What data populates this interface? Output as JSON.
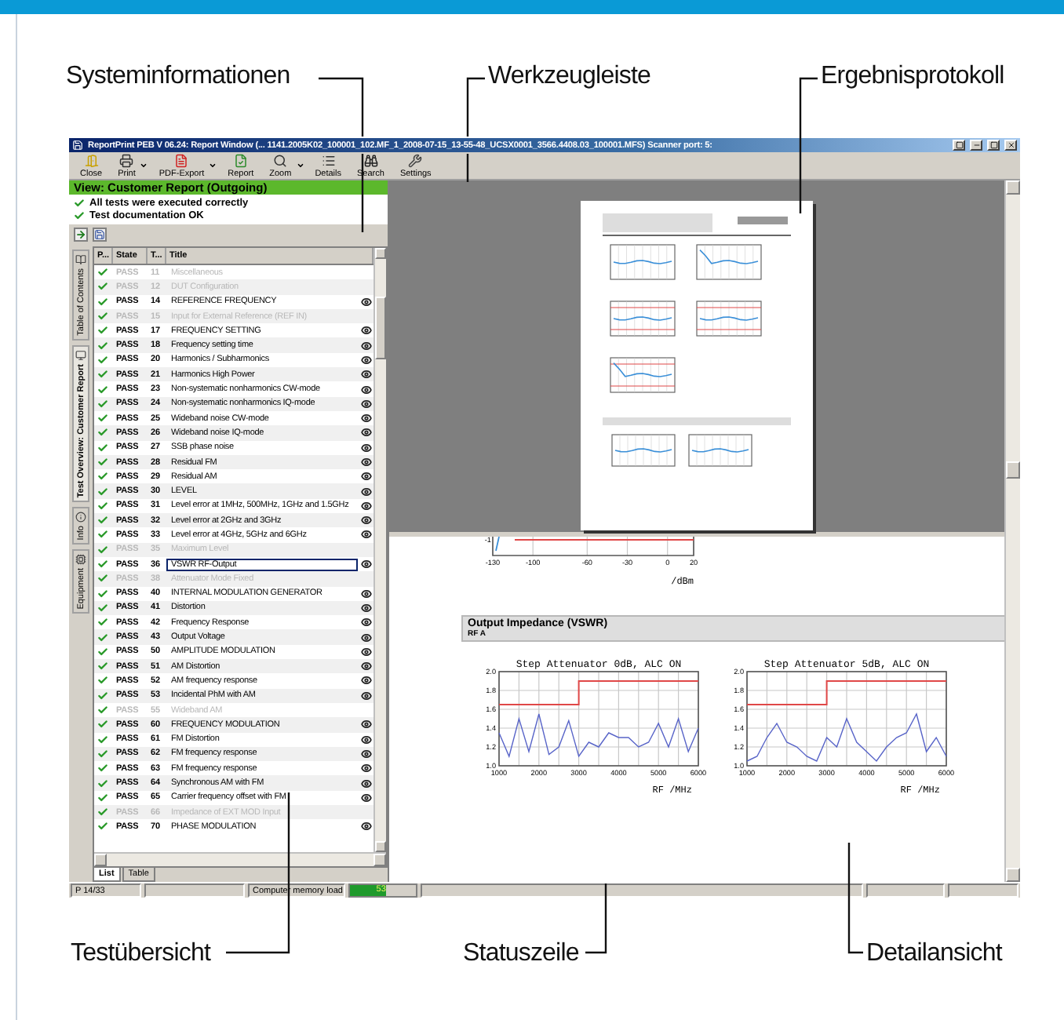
{
  "top_labels": [
    {
      "text": "Systeminformationen"
    },
    {
      "text": "Werkzeugleiste"
    },
    {
      "text": "Ergebnisprotokoll"
    }
  ],
  "window": {
    "title": "ReportPrint PEB  V 06.24: Report Window (... 1141.2005K02_100001_102.MF_1_2008-07-15_13-55-48_UCSX0001_3566.4408.03_100001.MFS) Scanner port: 5:",
    "toolbar": [
      {
        "label": "Close",
        "kind": "close",
        "dropdown": false
      },
      {
        "label": "Print",
        "kind": "print",
        "dropdown": true
      },
      {
        "label": "PDF-Export",
        "kind": "pdf",
        "dropdown": true
      },
      {
        "label": "Report",
        "kind": "report",
        "dropdown": false
      },
      {
        "label": "Zoom",
        "kind": "zoom",
        "dropdown": true
      },
      {
        "label": "Details",
        "kind": "details",
        "dropdown": false
      },
      {
        "label": "Search",
        "kind": "search",
        "dropdown": false
      },
      {
        "label": "Settings",
        "kind": "settings",
        "dropdown": false
      }
    ]
  },
  "view_header": "View: Customer Report (Outgoing)",
  "system_messages": [
    {
      "text": "All tests were executed correctly"
    },
    {
      "text": "Test documentation OK"
    }
  ],
  "side_tabs": [
    {
      "label": "Table of Contents",
      "selected": false
    },
    {
      "label": "Test Overview: Customer Report",
      "selected": true
    },
    {
      "label": "Info",
      "selected": false
    },
    {
      "label": "Equipment",
      "selected": false
    }
  ],
  "test_list": {
    "columns": [
      "P...",
      "State",
      "T...",
      "Title"
    ],
    "rows": [
      {
        "state": "PASS",
        "number": "11",
        "title": "Miscellaneous",
        "enabled": false,
        "selected": false
      },
      {
        "state": "PASS",
        "number": "12",
        "title": "DUT Configuration",
        "enabled": false,
        "selected": false
      },
      {
        "state": "PASS",
        "number": "14",
        "title": "REFERENCE FREQUENCY",
        "enabled": true,
        "selected": false
      },
      {
        "state": "PASS",
        "number": "15",
        "title": "Input for External Reference (REF IN)",
        "enabled": false,
        "selected": false
      },
      {
        "state": "PASS",
        "number": "17",
        "title": "FREQUENCY SETTING",
        "enabled": true,
        "selected": false
      },
      {
        "state": "PASS",
        "number": "18",
        "title": "Frequency setting time",
        "enabled": true,
        "selected": false
      },
      {
        "state": "PASS",
        "number": "20",
        "title": "Harmonics / Subharmonics",
        "enabled": true,
        "selected": false
      },
      {
        "state": "PASS",
        "number": "21",
        "title": "Harmonics High Power",
        "enabled": true,
        "selected": false
      },
      {
        "state": "PASS",
        "number": "23",
        "title": "Non-systematic nonharmonics CW-mode",
        "enabled": true,
        "selected": false
      },
      {
        "state": "PASS",
        "number": "24",
        "title": "Non-systematic nonharmonics IQ-mode",
        "enabled": true,
        "selected": false
      },
      {
        "state": "PASS",
        "number": "25",
        "title": "Wideband noise CW-mode",
        "enabled": true,
        "selected": false
      },
      {
        "state": "PASS",
        "number": "26",
        "title": "Wideband noise IQ-mode",
        "enabled": true,
        "selected": false
      },
      {
        "state": "PASS",
        "number": "27",
        "title": "SSB phase noise",
        "enabled": true,
        "selected": false
      },
      {
        "state": "PASS",
        "number": "28",
        "title": "Residual FM",
        "enabled": true,
        "selected": false
      },
      {
        "state": "PASS",
        "number": "29",
        "title": "Residual AM",
        "enabled": true,
        "selected": false
      },
      {
        "state": "PASS",
        "number": "30",
        "title": "LEVEL",
        "enabled": true,
        "selected": false
      },
      {
        "state": "PASS",
        "number": "31",
        "title": "Level error at 1MHz, 500MHz, 1GHz and 1.5GHz",
        "enabled": true,
        "selected": false
      },
      {
        "state": "PASS",
        "number": "32",
        "title": "Level error at 2GHz and 3GHz",
        "enabled": true,
        "selected": false
      },
      {
        "state": "PASS",
        "number": "33",
        "title": "Level error at 4GHz, 5GHz and 6GHz",
        "enabled": true,
        "selected": false
      },
      {
        "state": "PASS",
        "number": "35",
        "title": "Maximum Level",
        "enabled": false,
        "selected": false
      },
      {
        "state": "PASS",
        "number": "36",
        "title": "VSWR RF-Output",
        "enabled": true,
        "selected": true
      },
      {
        "state": "PASS",
        "number": "38",
        "title": "Attenuator Mode Fixed",
        "enabled": false,
        "selected": false
      },
      {
        "state": "PASS",
        "number": "40",
        "title": "INTERNAL MODULATION GENERATOR",
        "enabled": true,
        "selected": false
      },
      {
        "state": "PASS",
        "number": "41",
        "title": "Distortion",
        "enabled": true,
        "selected": false
      },
      {
        "state": "PASS",
        "number": "42",
        "title": "Frequency Response",
        "enabled": true,
        "selected": false
      },
      {
        "state": "PASS",
        "number": "43",
        "title": "Output Voltage",
        "enabled": true,
        "selected": false
      },
      {
        "state": "PASS",
        "number": "50",
        "title": "AMPLITUDE MODULATION",
        "enabled": true,
        "selected": false
      },
      {
        "state": "PASS",
        "number": "51",
        "title": "AM Distortion",
        "enabled": true,
        "selected": false
      },
      {
        "state": "PASS",
        "number": "52",
        "title": "AM frequency response",
        "enabled": true,
        "selected": false
      },
      {
        "state": "PASS",
        "number": "53",
        "title": "Incidental PhM with AM",
        "enabled": true,
        "selected": false
      },
      {
        "state": "PASS",
        "number": "55",
        "title": "Wideband AM",
        "enabled": false,
        "selected": false
      },
      {
        "state": "PASS",
        "number": "60",
        "title": "FREQUENCY MODULATION",
        "enabled": true,
        "selected": false
      },
      {
        "state": "PASS",
        "number": "61",
        "title": "FM Distortion",
        "enabled": true,
        "selected": false
      },
      {
        "state": "PASS",
        "number": "62",
        "title": "FM frequency response",
        "enabled": true,
        "selected": false
      },
      {
        "state": "PASS",
        "number": "63",
        "title": "FM frequency response",
        "enabled": true,
        "selected": false
      },
      {
        "state": "PASS",
        "number": "64",
        "title": "Synchronous AM with FM",
        "enabled": true,
        "selected": false
      },
      {
        "state": "PASS",
        "number": "65",
        "title": "Carrier frequency offset with FM",
        "enabled": true,
        "selected": false
      },
      {
        "state": "PASS",
        "number": "66",
        "title": "Impedance of EXT MOD Input",
        "enabled": false,
        "selected": false
      },
      {
        "state": "PASS",
        "number": "70",
        "title": "PHASE MODULATION",
        "enabled": true,
        "selected": false
      }
    ]
  },
  "list_tabs": [
    {
      "label": "List",
      "selected": true
    },
    {
      "label": "Table",
      "selected": false
    }
  ],
  "detail": {
    "level_chart": {
      "y_tick_label": "-1",
      "x_tick_labels": [
        "-130",
        "-100",
        "-60",
        "-30",
        "0",
        "20"
      ],
      "axis_label": "/dBm"
    },
    "section": {
      "title": "Output Impedance (VSWR)",
      "subtitle": "RF A"
    },
    "charts": [
      {
        "chart_data": {
          "type": "line",
          "title": "Step Attenuator 0dB,  ALC ON",
          "xlabel": "RF /MHz",
          "grid": true,
          "x": [
            1000,
            1250,
            1500,
            1750,
            2000,
            2250,
            2500,
            2750,
            3000,
            3000,
            3250,
            3500,
            3750,
            4000,
            4250,
            4500,
            4750,
            5000,
            5250,
            5500,
            5750,
            6000
          ],
          "xlim": [
            1000,
            6000
          ],
          "ylim": [
            1,
            2
          ],
          "xticks": [
            1000,
            2000,
            3000,
            4000,
            5000,
            6000
          ],
          "yticks": [
            {
              "value": 1,
              "label": "1.0"
            },
            {
              "value": 1.2,
              "label": "1.2"
            },
            {
              "value": 1.4,
              "label": "1.4"
            },
            {
              "value": 1.6,
              "label": "1.6"
            },
            {
              "value": 1.8,
              "label": "1.8"
            },
            {
              "value": 2,
              "label": "2.0"
            }
          ],
          "series": [
            {
              "color": "#5864c8",
              "values": [
                1.35,
                1.1,
                1.5,
                1.15,
                1.55,
                1.12,
                1.2,
                1.48,
                1.1,
                1.1,
                1.25,
                1.2,
                1.35,
                1.3,
                1.3,
                1.2,
                1.25,
                1.45,
                1.2,
                1.5,
                1.15,
                1.4
              ]
            },
            {
              "color": "#e04848",
              "values": [
                1.65,
                1.65,
                1.65,
                1.65,
                1.65,
                1.65,
                1.65,
                1.65,
                1.65,
                1.9,
                1.9,
                1.9,
                1.9,
                1.9,
                1.9,
                1.9,
                1.9,
                1.9,
                1.9,
                1.9,
                1.9,
                1.9
              ]
            }
          ]
        }
      },
      {
        "chart_data": {
          "type": "line",
          "title": "Step Attenuator 5dB,  ALC ON",
          "xlabel": "RF /MHz",
          "grid": true,
          "x": [
            1000,
            1250,
            1500,
            1750,
            2000,
            2250,
            2500,
            2750,
            3000,
            3000,
            3250,
            3500,
            3750,
            4000,
            4250,
            4500,
            4750,
            5000,
            5250,
            5500,
            5750,
            6000
          ],
          "xlim": [
            1000,
            6000
          ],
          "ylim": [
            1,
            2
          ],
          "xticks": [
            1000,
            2000,
            3000,
            4000,
            5000,
            6000
          ],
          "yticks": [
            {
              "value": 1,
              "label": "1.0"
            },
            {
              "value": 1.2,
              "label": "1.2"
            },
            {
              "value": 1.4,
              "label": "1.4"
            },
            {
              "value": 1.6,
              "label": "1.6"
            },
            {
              "value": 1.8,
              "label": "1.8"
            },
            {
              "value": 2,
              "label": "2.0"
            }
          ],
          "series": [
            {
              "color": "#5864c8",
              "values": [
                1.05,
                1.1,
                1.3,
                1.45,
                1.25,
                1.2,
                1.1,
                1.05,
                1.3,
                1.3,
                1.2,
                1.5,
                1.25,
                1.15,
                1.05,
                1.2,
                1.3,
                1.35,
                1.55,
                1.15,
                1.3,
                1.1
              ]
            },
            {
              "color": "#e04848",
              "values": [
                1.65,
                1.65,
                1.65,
                1.65,
                1.65,
                1.65,
                1.65,
                1.65,
                1.65,
                1.9,
                1.9,
                1.9,
                1.9,
                1.9,
                1.9,
                1.9,
                1.9,
                1.9,
                1.9,
                1.9,
                1.9,
                1.9
              ]
            }
          ]
        }
      }
    ]
  },
  "status_bar": {
    "page": "P 14/33",
    "memory_label": "Computer memory load",
    "memory_meter": {
      "level": 0.55,
      "reading": "53"
    }
  },
  "bottom_labels": [
    {
      "text": "Testübersicht"
    },
    {
      "text": "Statuszeile"
    },
    {
      "text": "Detailansicht"
    }
  ]
}
